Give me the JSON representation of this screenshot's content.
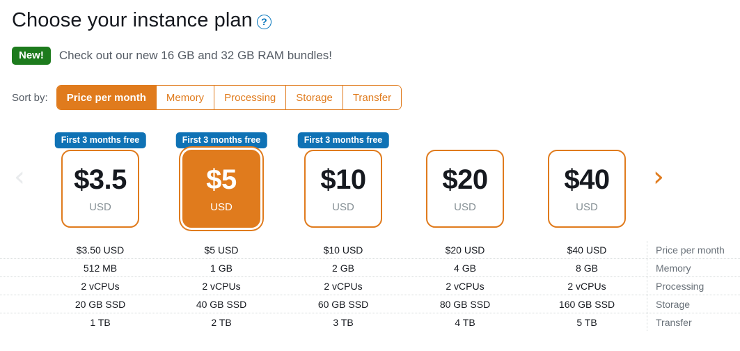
{
  "header": {
    "title": "Choose your instance plan",
    "help_icon": "question-mark-icon",
    "help_glyph": "?"
  },
  "promo": {
    "badge": "New!",
    "badge_color": "#1d7b1d",
    "text": "Check out our new 16 GB and 32 GB RAM bundles!"
  },
  "sort": {
    "label": "Sort by:",
    "active_index": 0,
    "accent_color": "#e07b1d",
    "tabs": [
      {
        "label": "Price per month"
      },
      {
        "label": "Memory"
      },
      {
        "label": "Processing"
      },
      {
        "label": "Storage"
      },
      {
        "label": "Transfer"
      }
    ]
  },
  "carousel": {
    "prev_glyph": "‹",
    "next_glyph": "›",
    "prev_enabled": false,
    "next_enabled": true,
    "prev_color": "#e9ebed",
    "next_color": "#e07b1d"
  },
  "plans": {
    "selected_index": 1,
    "badge_color": "#0f72b5",
    "cards": [
      {
        "price": "$3.5",
        "currency": "USD",
        "badge": "First 3 months free"
      },
      {
        "price": "$5",
        "currency": "USD",
        "badge": "First 3 months free"
      },
      {
        "price": "$10",
        "currency": "USD",
        "badge": "First 3 months free"
      },
      {
        "price": "$20",
        "currency": "USD",
        "badge": ""
      },
      {
        "price": "$40",
        "currency": "USD",
        "badge": ""
      }
    ]
  },
  "specs": {
    "rows": [
      {
        "label": "Price per month",
        "values": [
          "$3.50 USD",
          "$5 USD",
          "$10 USD",
          "$20 USD",
          "$40 USD"
        ]
      },
      {
        "label": "Memory",
        "values": [
          "512 MB",
          "1 GB",
          "2 GB",
          "4 GB",
          "8 GB"
        ]
      },
      {
        "label": "Processing",
        "values": [
          "2 vCPUs",
          "2 vCPUs",
          "2 vCPUs",
          "2 vCPUs",
          "2 vCPUs"
        ]
      },
      {
        "label": "Storage",
        "values": [
          "20 GB SSD",
          "40 GB SSD",
          "60 GB SSD",
          "80 GB SSD",
          "160 GB SSD"
        ]
      },
      {
        "label": "Transfer",
        "values": [
          "1 TB",
          "2 TB",
          "3 TB",
          "4 TB",
          "5 TB"
        ]
      }
    ]
  }
}
